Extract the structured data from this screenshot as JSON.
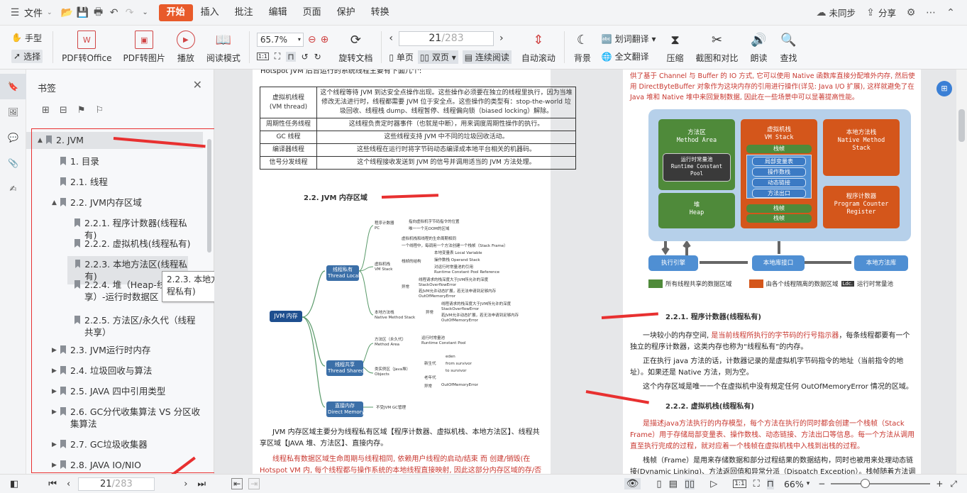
{
  "menubar": {
    "file": "文件",
    "tabs": [
      "开始",
      "插入",
      "批注",
      "编辑",
      "页面",
      "保护",
      "转换"
    ],
    "sync": "未同步",
    "share": "分享"
  },
  "ribbon": {
    "hand": "手型",
    "select": "选择",
    "pdf_office": "PDF转Office",
    "pdf_image": "PDF转图片",
    "play": "播放",
    "read_mode": "阅读模式",
    "zoom": "65.7%",
    "rotate": "旋转文档",
    "page_current": "21",
    "page_total": "/283",
    "single": "单页",
    "double": "双页",
    "continuous": "连续阅读",
    "auto_scroll": "自动滚动",
    "background": "背景",
    "translate_word": "划词翻译",
    "translate_full": "全文翻译",
    "compress": "压缩",
    "screenshot": "截图和对比",
    "read_aloud": "朗读",
    "find": "查找"
  },
  "bookmarks": {
    "title": "书签",
    "items": [
      {
        "label": "2. JVM",
        "level": 0,
        "expand": "▲"
      },
      {
        "label": "1. 目录",
        "level": 1,
        "expand": ""
      },
      {
        "label": "2.1. 线程",
        "level": 1,
        "expand": ""
      },
      {
        "label": "2.2. JVM内存区域",
        "level": 1,
        "expand": "▲"
      },
      {
        "label": "2.2.1. 程序计数器(线程私有)",
        "level": 2,
        "expand": ""
      },
      {
        "label": "2.2.2. 虚拟机栈(线程私有)",
        "level": 2,
        "expand": ""
      },
      {
        "label": "2.2.3. 本地方法区(线程私有)",
        "level": 2,
        "expand": ""
      },
      {
        "label": "2.2.4. 堆（Heap-线程共享）-运行时数据区",
        "level": 2,
        "expand": ""
      },
      {
        "label": "2.2.5. 方法区/永久代（线程共享）",
        "level": 2,
        "expand": ""
      },
      {
        "label": "2.3. JVM运行时内存",
        "level": 1,
        "expand": "▶"
      },
      {
        "label": "2.4. 垃圾回收与算法",
        "level": 1,
        "expand": "▶"
      },
      {
        "label": "2.5. JAVA 四中引用类型",
        "level": 1,
        "expand": "▶"
      },
      {
        "label": "2.6. GC分代收集算法  VS 分区收集算法",
        "level": 1,
        "expand": "▶"
      },
      {
        "label": "2.7. GC垃圾收集器",
        "level": 1,
        "expand": "▶"
      },
      {
        "label": "2.8.  JAVA IO/NIO",
        "level": 1,
        "expand": "▶"
      }
    ],
    "tooltip": "2.2.3. 本地方法区(线程私有)"
  },
  "left_page": {
    "intro": "Hotspot JVM 后台运行的系统线程主要有下面几个:",
    "table": [
      [
        "虚拟机线程\n(VM thread)",
        "这个线程等待 JVM 到达安全点操作出现。这些操作必须要在独立的线程里执行，因为当堆修改无法进行时，线程都需要 JVM 位于安全点。这些操作的类型有：stop-the-world 垃圾回收、线程栈 dump、线程暂停、线程偏向锁（biased locking）解除。"
      ],
      [
        "周期性任务线程",
        "这线程负责定时器事件（也就是中断），用来调度周期性操作的执行。"
      ],
      [
        "GC 线程",
        "这些线程支持 JVM 中不同的垃圾回收活动。"
      ],
      [
        "编译器线程",
        "这些线程在运行时将字节码动态编译成本地平台相关的机器码。"
      ],
      [
        "信号分发线程",
        "这个线程接收发送到 JVM 的信号并调用适当的 JVM 方法处理。"
      ]
    ],
    "section": "2.2. JVM 内存区域",
    "mindmap": {
      "root": "JVM 内存",
      "private": "线程私有\nThread Local",
      "shared": "线程共享\nThread Shared",
      "direct": "直接内存\nDirect Memory",
      "pc": "程序计数器\nPC",
      "pc_1": "指向虚拟机字节码指令的位置",
      "pc_2": "唯一一个无OOM的区域",
      "vms": "虚拟机栈\nVM Stack",
      "vms_1": "虚拟机栈和线程的生命周期相同",
      "vms_2": "一个线程中，每调用一个方法创建一个栈帧（Stack Frame）",
      "frame": "栈帧的结构",
      "frame_1": "本地变量表 Local Variable",
      "frame_2": "操作数栈 Operand Stack",
      "frame_3": "对运行时常量池的引用\nRuntime Constant Pool Reference",
      "exc": "异常",
      "exc_1": "线程请求的栈深度大于JVM所允许的深度\nStackOverflowError",
      "exc_2": "若JVM允许动态扩展，若无法申请到足够内存\nOutOfMemoryError",
      "nms": "本地方法栈\nNative Method Stack",
      "nms_exc": "异常",
      "nms_1": "线程请求的栈深度大于JVM所允许的深度\nStackOverflowError",
      "nms_2": "若JVM允许动态扩展，若无法申请到足够内存\nOutOfMemoryError",
      "ma": "方法区（永久代）\nMethod Area",
      "ma_1": "运行时常量池\nRuntime Constant Pool",
      "heap": "类实例区（Java堆）\nObjects",
      "young": "新生代",
      "eden": "eden",
      "from": "from survivor",
      "to": "to survivor",
      "old": "老年代",
      "heap_exc": "异常",
      "heap_oom": "OutOfMemoryError",
      "direct_1": "不受JVM GC管理"
    },
    "para1": "JVM 内存区域主要分为线程私有区域【程序计数器、虚拟机栈、本地方法区】、线程共享区域【JAVA 堆、方法区】、直接内存。",
    "para2": "线程私有数据区域生命周期与线程相同, 依赖用户线程的启动/结束 而 创建/销毁(在 Hotspot VM 内, 每个线程都与操作系统的本地线程直接映射, 因此这部分内存区域的存/否跟随本地线程的"
  },
  "right_page": {
    "top": "供了基于 Channel 与 Buffer 的 IO 方式, 它可以使用 Native 函数库直接分配堆外内存, 然后使用 DirectByteBuffer 对象作为这块内存的引用进行操作(详见: Java I/O 扩展), 这样就避免了在 Java 堆和 Native 堆中来回复制数据, 因此在一些场景中可以显著提高性能。",
    "diagram": {
      "method_area": "方法区\nMethod Area",
      "rcp": "运行时常量池\nRuntime Constant\nPool",
      "vm_stack": "虚拟机栈\nVM Stack",
      "frame": "栈帧",
      "frame_items": [
        "局部变量表",
        "操作数栈",
        "动态链接",
        "方法出口"
      ],
      "native_stack": "本地方法栈\nNative Method\nStack",
      "heap": "堆\nHeap",
      "pc": "程序计数器\nProgram Counter\nRegister",
      "engine": "执行引擎",
      "native_iface": "本地库接口",
      "native_lib": "本地方法库",
      "legend_shared": "所有线程共享的数据区域",
      "legend_private": "由各个线程隔离的数据区域",
      "legend_rcp": "运行时常量池",
      "legend_rcp_tag": "Ldc.",
      "colors": {
        "shared": "#4f8a3a",
        "private": "#d4561b",
        "bg": "#b6d0ea",
        "bottom": "#4f8fd3"
      }
    },
    "h1": "2.2.1.  程序计数器(线程私有)",
    "p1a": "一块较小的内存空间, ",
    "p1b": "是当前线程所执行的字节码的行号指示器",
    "p1c": "，每条线程都要有一个独立的程序计数器，这类内存也称为“线程私有”的内存。",
    "p2": "正在执行 java 方法的话，计数器记录的是虚拟机字节码指令的地址（当前指令的地址）。如果还是 Native 方法，则为空。",
    "p3": "这个内存区域是唯一一个在虚拟机中没有规定任何 OutOfMemoryError 情况的区域。",
    "h2": "2.2.2.  虚拟机栈(线程私有)",
    "p4": "是描述java方法执行的内存模型，每个方法在执行的同时都会创建一个栈帧（Stack Frame）用于存储局部变量表、操作数栈、动态链接、方法出口等信息。每一个方法从调用直至执行完成的过程，就对应着一个栈帧在虚拟机栈中入栈到出栈的过程。",
    "p5": "栈帧（Frame）是用来存储数据和部分过程结果的数据结构，同时也被用来处理动态链接(Dynamic Linking)、方法返回值和异常分派（Dispatch Exception）。栈帧随着方法调用而创"
  },
  "status": {
    "page_current": "21",
    "page_total": "/283",
    "zoom": "66%"
  }
}
